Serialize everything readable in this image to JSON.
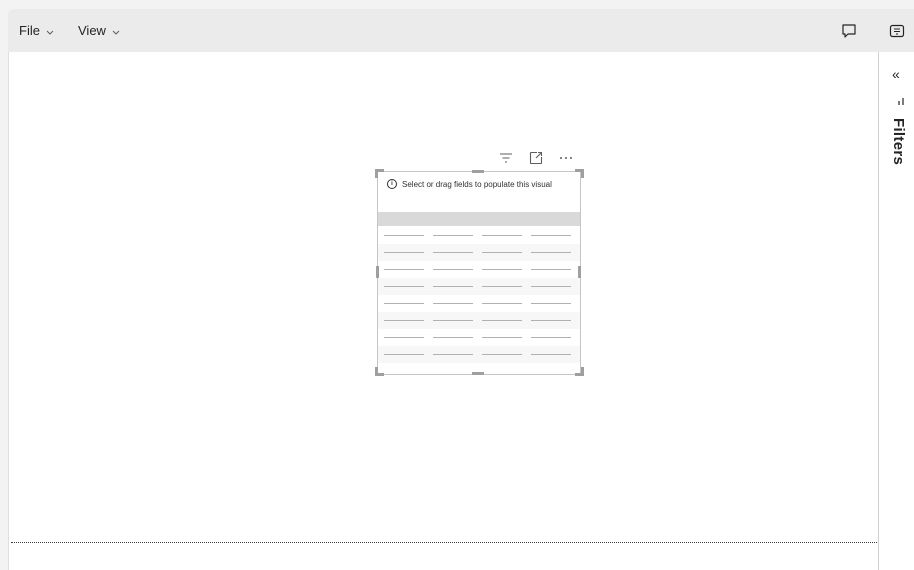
{
  "menu": {
    "file_label": "File",
    "view_label": "View",
    "chevron": "⌄"
  },
  "toolbar_icons": {
    "comment": "comment-icon",
    "panel": "panel-icon"
  },
  "visual": {
    "message": "Select or drag fields to populate this visual",
    "info_glyph": "i",
    "header_icons": [
      "filter-icon",
      "focus-mode-icon",
      "more-options-icon"
    ],
    "placeholder_columns": 4,
    "placeholder_rows": 8
  },
  "filters_pane": {
    "collapse_glyph": "«",
    "label": "Filters"
  },
  "colors": {
    "menubar": "#ebebeb",
    "canvas": "#ffffff",
    "handle": "#a19f9d",
    "table_header": "#d9d9d9"
  }
}
